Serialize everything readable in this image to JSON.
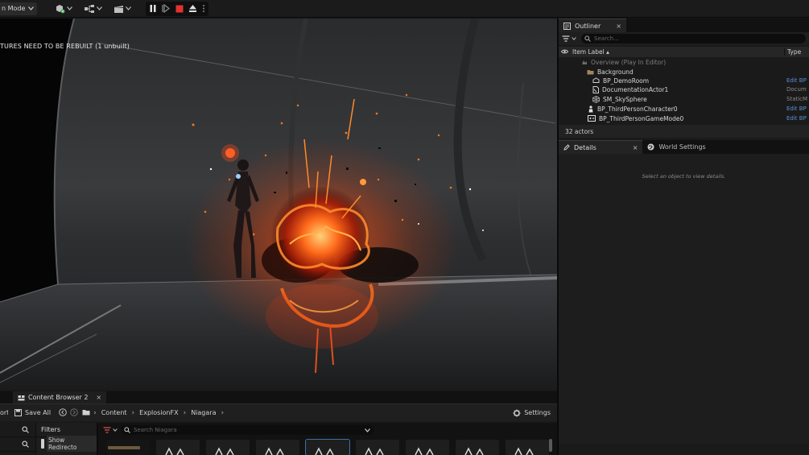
{
  "toolbar": {
    "mode_label": "n Mode"
  },
  "viewport": {
    "warning": "TURES NEED TO BE REBUILT (1 unbuilt)"
  },
  "outliner": {
    "tab_label": "Outliner",
    "close": "×",
    "search_placeholder": "Search...",
    "col_label": "Item Label ▴",
    "col_type": "Type",
    "rows": [
      {
        "label": "Overview (Play In Editor)",
        "type": ""
      },
      {
        "label": "Background",
        "type": ""
      },
      {
        "label": "BP_DemoRoom",
        "type": "Edit BP"
      },
      {
        "label": "DocumentationActor1",
        "type": "Docum"
      },
      {
        "label": "SM_SkySphere",
        "type": "StaticM"
      },
      {
        "label": "BP_ThirdPersonCharacter0",
        "type": "Edit BP"
      },
      {
        "label": "BP_ThirdPersonGameMode0",
        "type": "Edit BP"
      }
    ],
    "status": "32 actors"
  },
  "details": {
    "tab_label": "Details",
    "close": "×",
    "world_settings_label": "World Settings",
    "hint": "Select an object to view details."
  },
  "content_browser": {
    "tab_label": "Content Browser 2",
    "close": "×",
    "import_label": "ort",
    "save_all_label": "Save All",
    "breadcrumbs": [
      "Content",
      "ExplosionFX",
      "Niagara"
    ],
    "settings_label": "Settings",
    "filters_label": "Filters",
    "show_redirectors_label": "Show Redirecto",
    "search_placeholder": "Search Niagara"
  },
  "colors": {
    "accent_blue": "#5d8fd6",
    "stop_red": "#e0332e",
    "fire_orange": "#ff6a1a"
  }
}
